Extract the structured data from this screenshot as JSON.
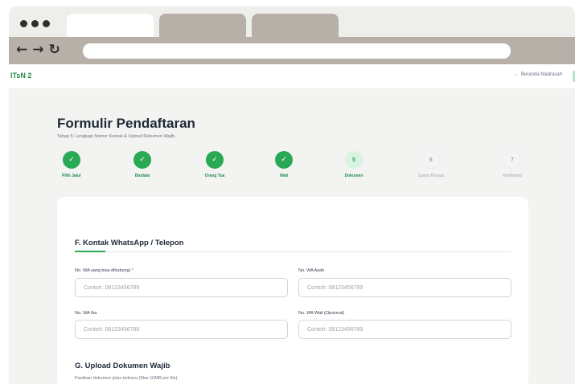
{
  "browser": {
    "tabs": [
      "",
      "",
      ""
    ],
    "address": ""
  },
  "header": {
    "brand": "ITsN 2",
    "home_link": "Beranda Madrasah",
    "home_arrow": "←"
  },
  "form": {
    "title": "Formulir Pendaftaran",
    "subtitle": "Tahap 5: Lengkapi Nomor Kontak & Upload Dokumen Wajib."
  },
  "steps": [
    {
      "label": "Pilih Jalur",
      "mark": "✓",
      "state": "done"
    },
    {
      "label": "Biodata",
      "mark": "✓",
      "state": "done"
    },
    {
      "label": "Orang Tua",
      "mark": "✓",
      "state": "done"
    },
    {
      "label": "Wali",
      "mark": "✓",
      "state": "done"
    },
    {
      "label": "Dokumen",
      "mark": "5",
      "state": "active"
    },
    {
      "label": "Syarat Khusus",
      "mark": "6",
      "state": "todo"
    },
    {
      "label": "Konfirmasi",
      "mark": "7",
      "state": "todo"
    }
  ],
  "contact": {
    "section_title": "F. Kontak WhatsApp / Telepon",
    "fields": {
      "wa_student": {
        "label": "No. WA yang bisa dihubungi",
        "required_mark": "*",
        "placeholder": "Contoh: 08123456789"
      },
      "wa_father": {
        "label": "No. WA Ayah",
        "placeholder": "Contoh: 08123456789"
      },
      "wa_mother": {
        "label": "No. WA Ibu",
        "placeholder": "Contoh: 08123456789"
      },
      "wa_guardian": {
        "label": "No. WA Wali (Opsional)",
        "placeholder": "Contoh: 08123456789"
      }
    }
  },
  "upload": {
    "section_title": "G. Upload Dokumen Wajib",
    "description": "Pastikan dokumen jelas terbaca (Max 10MB per file)."
  },
  "colors": {
    "accent": "#2aa955",
    "accent_light": "#d9f2e2",
    "required": "#e11d48",
    "chrome": "#b7b0a8"
  }
}
